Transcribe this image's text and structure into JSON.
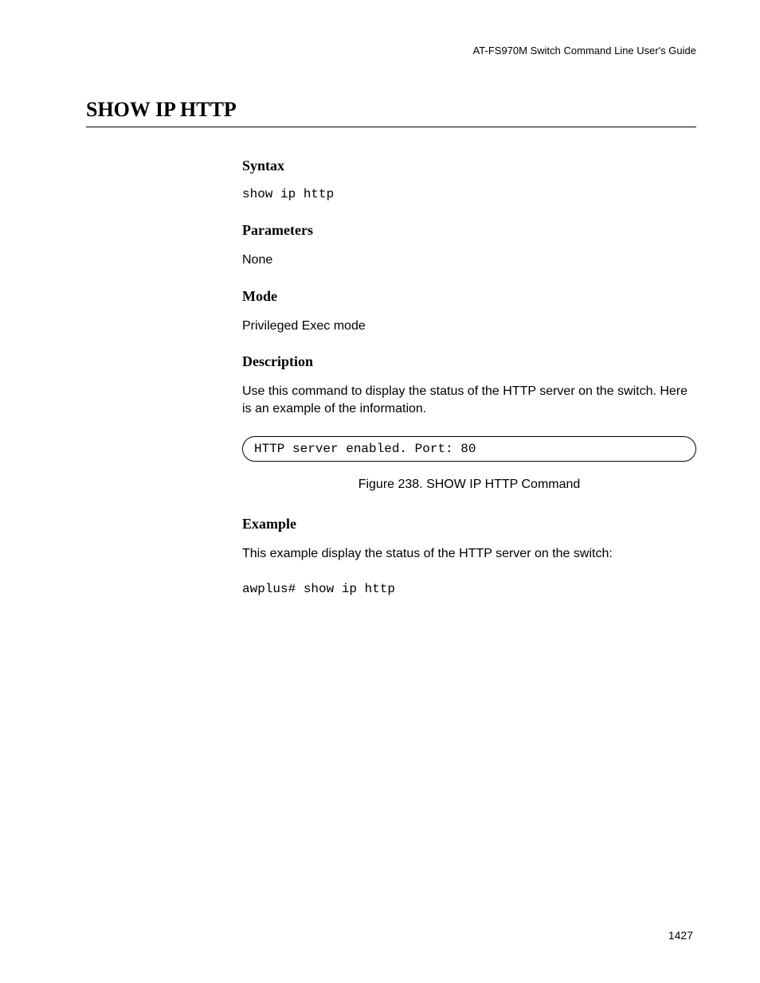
{
  "header": {
    "running_head": "AT-FS970M Switch Command Line User's Guide"
  },
  "title": "SHOW IP HTTP",
  "sections": {
    "syntax": {
      "heading": "Syntax",
      "code": "show ip http"
    },
    "parameters": {
      "heading": "Parameters",
      "text": "None"
    },
    "mode": {
      "heading": "Mode",
      "text": "Privileged Exec mode"
    },
    "description": {
      "heading": "Description",
      "text": "Use this command to display the status of the HTTP server on the switch. Here is an example of the information.",
      "output": "HTTP server enabled. Port: 80",
      "figure_caption": "Figure 238. SHOW IP HTTP Command"
    },
    "example": {
      "heading": "Example",
      "text": "This example display the status of the HTTP server on the switch:",
      "code": "awplus# show ip http"
    }
  },
  "page_number": "1427"
}
